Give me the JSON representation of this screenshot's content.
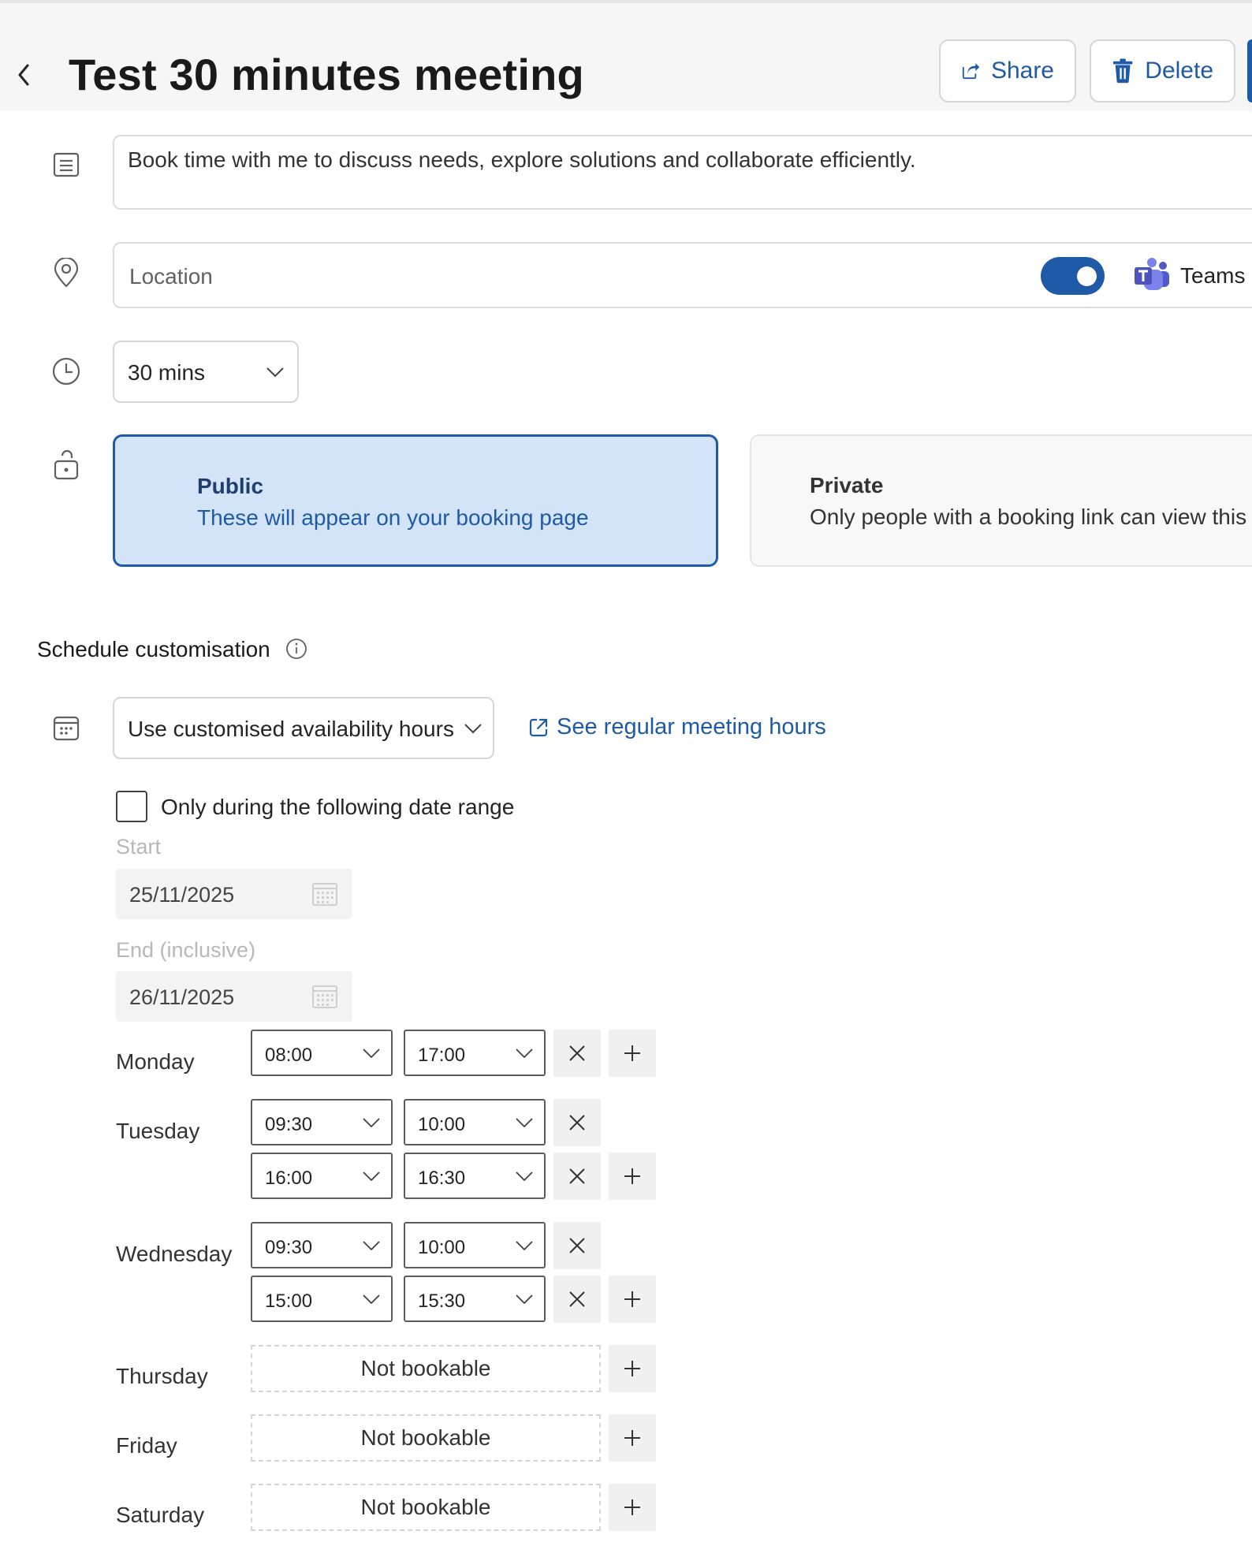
{
  "header": {
    "title": "Test 30 minutes meeting",
    "share_label": "Share",
    "delete_label": "Delete"
  },
  "description": {
    "value": "Book time with me to discuss needs, explore solutions and collaborate efficiently."
  },
  "location": {
    "placeholder": "Location",
    "online_toggle_on": true,
    "teams_label": "Teams r"
  },
  "duration": {
    "value": "30 mins"
  },
  "visibility": {
    "public": {
      "title": "Public",
      "text": "These will appear on your booking page"
    },
    "private": {
      "title": "Private",
      "text": "Only people with a booking link can view this"
    },
    "selected": "public"
  },
  "schedule": {
    "title": "Schedule customisation",
    "availability_value": "Use customised availability hours",
    "see_hours_link": "See regular meeting hours",
    "date_range_label": "Only during the following date range",
    "date_range_checked": false,
    "start_label": "Start",
    "start_value": "25/11/2025",
    "end_label": "End (inclusive)",
    "end_value": "26/11/2025"
  },
  "days": [
    {
      "name": "Monday",
      "slots": [
        {
          "start": "08:00",
          "end": "17:00"
        }
      ]
    },
    {
      "name": "Tuesday",
      "slots": [
        {
          "start": "09:30",
          "end": "10:00"
        },
        {
          "start": "16:00",
          "end": "16:30"
        }
      ]
    },
    {
      "name": "Wednesday",
      "slots": [
        {
          "start": "09:30",
          "end": "10:00"
        },
        {
          "start": "15:00",
          "end": "15:30"
        }
      ]
    },
    {
      "name": "Thursday",
      "not_bookable": "Not bookable"
    },
    {
      "name": "Friday",
      "not_bookable": "Not bookable"
    },
    {
      "name": "Saturday",
      "not_bookable": "Not bookable"
    }
  ],
  "colors": {
    "accent": "#1f5aa6",
    "public_card_bg": "#d4e4f8",
    "header_bg": "#f6f6f6"
  }
}
